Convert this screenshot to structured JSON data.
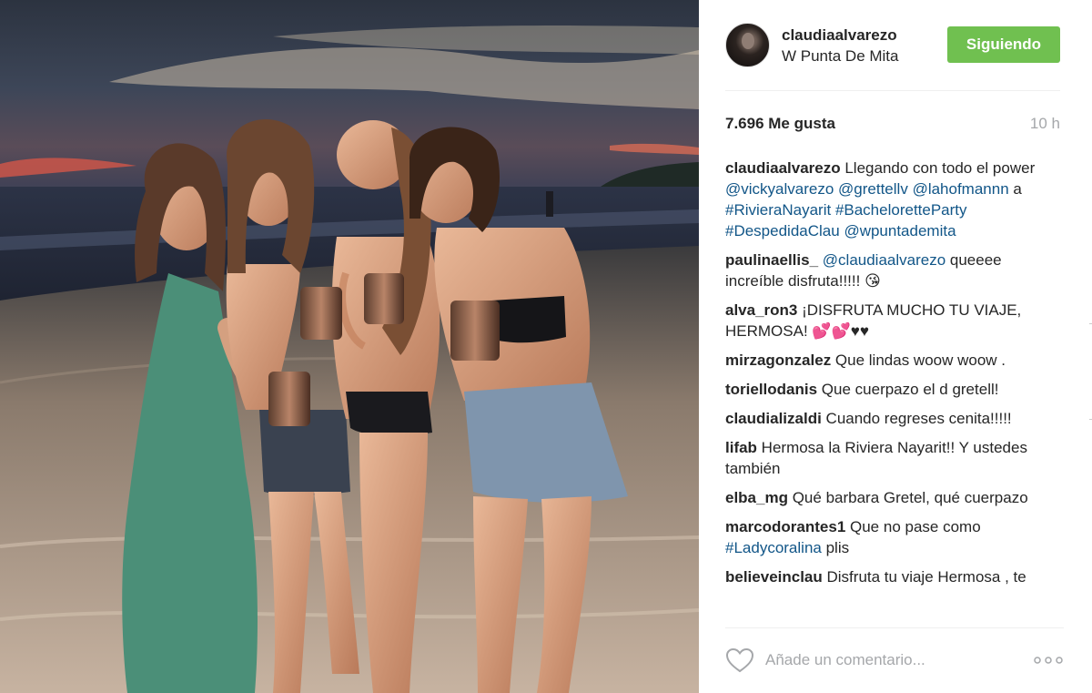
{
  "post": {
    "username": "claudiaalvarezo",
    "location": "W Punta De Mita",
    "follow_label": "Siguiendo",
    "likes": "7.696 Me gusta",
    "time": "10 h",
    "caption": {
      "user": "claudiaalvarezo",
      "text1": " Llegando con todo el power ",
      "mention1": "@vickyalvarezo",
      "space1": " ",
      "mention2": "@grettellv",
      "space2": " ",
      "mention3": "@lahofmannn",
      "text2": " a ",
      "tag1": "#RivieraNayarit",
      "space3": " ",
      "tag2": "#BacheloretteParty",
      "space4": " ",
      "tag3": "#DespedidaClau",
      "space5": " ",
      "mention4": "@wpuntademita"
    },
    "comments": [
      {
        "user": "paulinaellis_",
        "link": "@claudiaalvarezo",
        "text": " queeee increíble disfruta!!!!! 😘"
      },
      {
        "user": "alva_ron3",
        "link": "",
        "text": " ¡DISFRUTA MUCHO TU VIAJE, HERMOSA! 💕💕♥♥"
      },
      {
        "user": "mirzagonzalez",
        "link": "",
        "text": " Que lindas woow woow ."
      },
      {
        "user": "toriellodanis",
        "link": "",
        "text": " Que cuerpazo el d gretell!"
      },
      {
        "user": "claudializaldi",
        "link": "",
        "text": " Cuando regreses cenita!!!!!"
      },
      {
        "user": "lifab",
        "link": "",
        "text": " Hermosa la Riviera Nayarit!! Y ustedes también"
      },
      {
        "user": "elba_mg",
        "link": "",
        "text": " Qué barbara Gretel, qué cuerpazo"
      },
      {
        "user": "marcodorantes1",
        "link": "",
        "text": " Que no pase como ",
        "link_after": "#Ladycoralina",
        "text_after": " plis"
      },
      {
        "user": "believeinclau",
        "link": "",
        "text": " Disfruta tu viaje Hermosa , te"
      }
    ],
    "comment_placeholder": "Añade un comentario...",
    "icons": {
      "like": "heart-outline-icon",
      "more": "ellipsis-icon"
    }
  },
  "colors": {
    "follow_button": "#70c050",
    "link": "#125688",
    "muted": "#a5a7aa"
  }
}
